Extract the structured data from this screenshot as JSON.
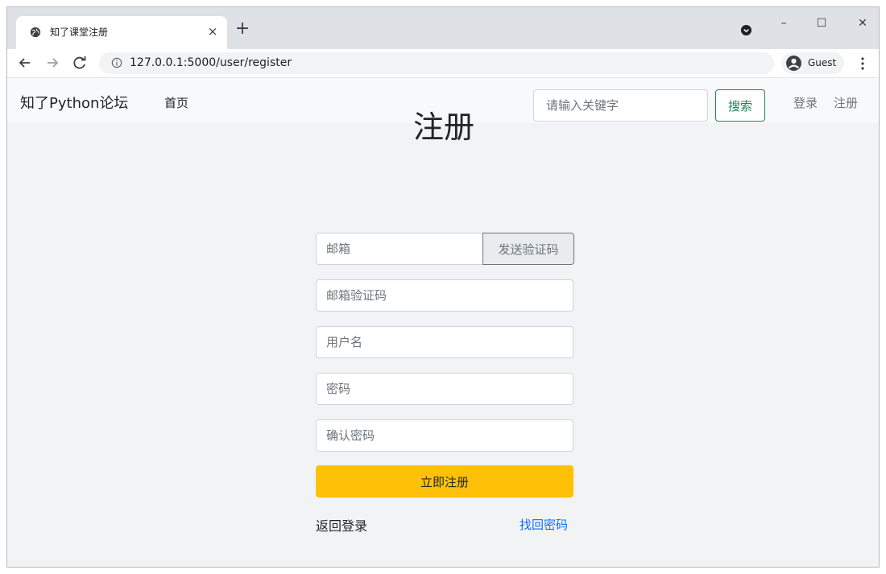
{
  "browser": {
    "tab_title": "知了课堂注册",
    "tab_close": "×",
    "new_tab": "+",
    "url": "127.0.0.1:5000/user/register",
    "profile_label": "Guest",
    "window_controls": {
      "minimize": "–",
      "maximize": "☐",
      "close": "✕"
    },
    "icons": [
      "globe-icon",
      "close-icon",
      "plus-icon",
      "tab-search-icon",
      "back-arrow-icon",
      "forward-arrow-icon",
      "reload-icon",
      "info-icon",
      "profile-icon",
      "kebab-menu-icon"
    ]
  },
  "navbar": {
    "brand": "知了Python论坛",
    "home": "首页",
    "search_placeholder": "请输入关键字",
    "search_button": "搜索",
    "login": "登录",
    "register": "注册"
  },
  "form": {
    "title": "注册",
    "email_placeholder": "邮箱",
    "send_code_button": "发送验证码",
    "captcha_placeholder": "邮箱验证码",
    "username_placeholder": "用户名",
    "password_placeholder": "密码",
    "password_confirm_placeholder": "确认密码",
    "submit_button": "立即注册",
    "back_to_login": "返回登录",
    "forgot_password": "找回密码"
  },
  "colors": {
    "submit_bg": "#ffc107",
    "search_btn": "#198754",
    "link_blue": "#0d6efd",
    "page_bg": "#f1f3f4",
    "navbar_bg": "#f8f9fa"
  }
}
